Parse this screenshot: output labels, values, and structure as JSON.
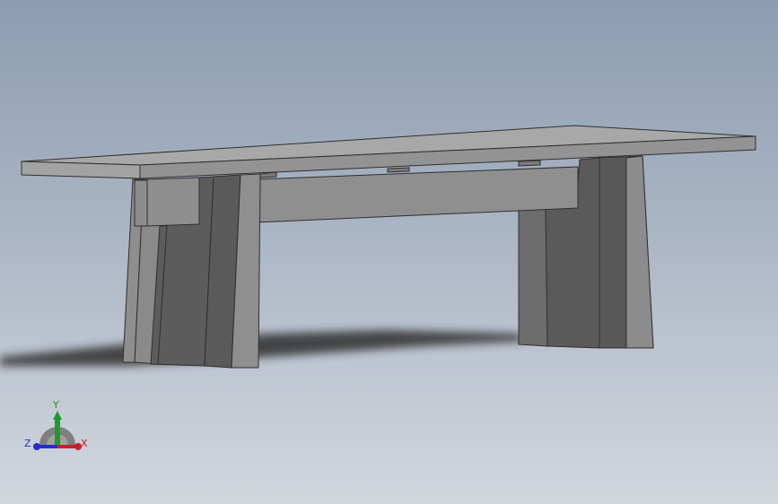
{
  "viewport": {
    "model": "bench-assembly"
  },
  "triad": {
    "x_label": "X",
    "y_label": "Y",
    "z_label": "Z"
  },
  "colors": {
    "x_axis": "#c8202c",
    "y_axis": "#1f9a2e",
    "z_axis": "#2a2ad0",
    "face_top": "#a9a9a9",
    "face_front": "#8e8e8e",
    "face_dark": "#5a5a5a",
    "edge": "#2f2f2f"
  },
  "icons": {
    "triad": "axis-triad-icon"
  }
}
